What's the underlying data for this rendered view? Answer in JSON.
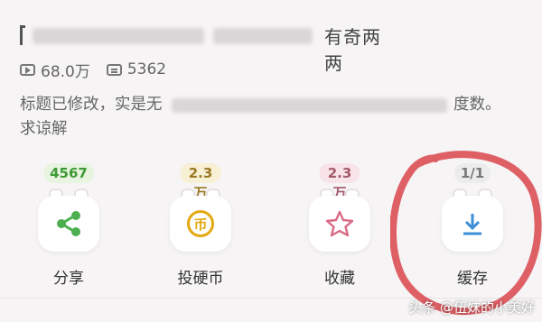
{
  "video": {
    "title_tail": "有奇两两",
    "views": "68.0万",
    "danmaku": "5362",
    "description_start": "标题已修改，实是无",
    "description_end": "度数。",
    "description_line2": "求谅解"
  },
  "actions": [
    {
      "label": "分享",
      "count": "4567",
      "icon": "share-icon"
    },
    {
      "label": "投硬币",
      "count": "2.3万",
      "icon": "coin-icon"
    },
    {
      "label": "收藏",
      "count": "2.3万",
      "icon": "star-icon"
    },
    {
      "label": "缓存",
      "count": "1/1",
      "icon": "download-icon"
    }
  ],
  "colors": {
    "share": "#4caf50",
    "coin": "#e2a911",
    "star": "#d96a86",
    "download": "#3d8fd8",
    "annotation": "#d9454b"
  },
  "watermark": "头条 @伍妹的小美好"
}
